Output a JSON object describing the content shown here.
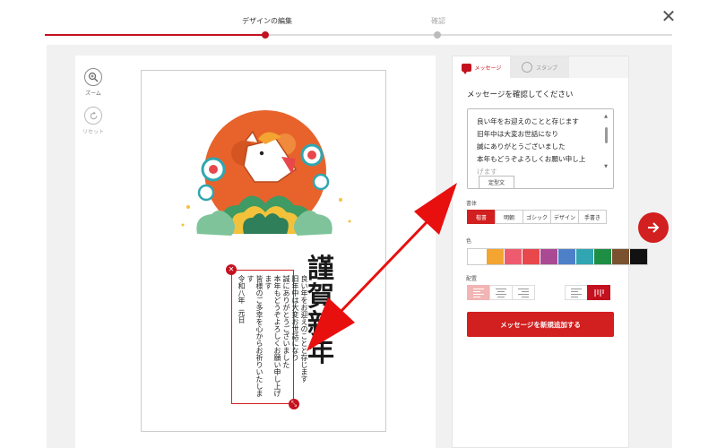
{
  "stepper": {
    "steps": [
      {
        "label": "デザインの編集",
        "state": "active"
      },
      {
        "label": "確認",
        "state": "inactive"
      }
    ],
    "active_color": "#c4111f",
    "inactive_color": "#bbbbbb"
  },
  "tools": {
    "zoom_label": "ズーム",
    "reset_label": "リセット"
  },
  "card": {
    "greeting_chars": [
      "謹",
      "賀",
      "新",
      "年"
    ],
    "message_lines": [
      "良い年をお迎えのことと存じます",
      "旧年中は大変お世話になり",
      "誠にありがとうございました",
      "本年もどうぞよろしくお願い申し上げます",
      "皆様のご多幸を心からお祈りいたします"
    ],
    "date_text": "令和八年",
    "date_suffix": "元日"
  },
  "panel": {
    "tabs": {
      "message": "メッセージ",
      "stamp": "スタンプ"
    },
    "title": "メッセージを確認してください",
    "textarea_lines": [
      "良い年をお迎えのことと存じます",
      "旧年中は大変お世話になり",
      "誠にありがとうございました",
      "本年もどうぞよろしくお願い申し上",
      "げます"
    ],
    "template_button": "定型文",
    "font_label": "書体",
    "fonts": [
      "楷書",
      "明朝",
      "ゴシック",
      "デザイン",
      "手書き"
    ],
    "selected_font": "楷書",
    "color_label": "色",
    "colors": [
      "#ffffff",
      "#f3a431",
      "#ef5b6e",
      "#e8474b",
      "#a94a93",
      "#4e7fc9",
      "#2fa6b1",
      "#1e8e45",
      "#7a5230",
      "#111111"
    ],
    "layout_label": "配置",
    "add_button": "メッセージを新規追加する"
  },
  "annotation": {
    "arrow_color": "#e8100f"
  }
}
